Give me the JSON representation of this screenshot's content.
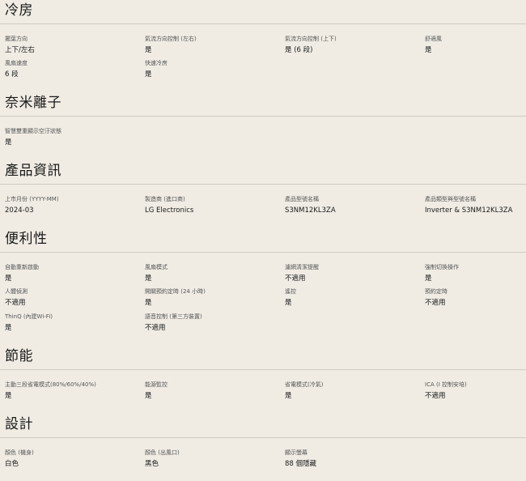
{
  "sections": [
    {
      "title": "冷房",
      "specs": [
        {
          "label": "擺葉方向",
          "value": "上下/左右"
        },
        {
          "label": "氣流方向控制 (左右)",
          "value": "是"
        },
        {
          "label": "氣流方向控制 (上下)",
          "value": "是 (6 段)"
        },
        {
          "label": "舒適風",
          "value": "是"
        },
        {
          "label": "風扇速度",
          "value": "6 段"
        },
        {
          "label": "快速冷房",
          "value": "是"
        }
      ]
    },
    {
      "title": "奈米離子",
      "specs": [
        {
          "label": "智慧雙重顯示空汙狀態",
          "value": "是"
        }
      ]
    },
    {
      "title": "產品資訊",
      "specs": [
        {
          "label": "上市月份 (YYYY-MM)",
          "value": "2024-03"
        },
        {
          "label": "製造商 (進口商)",
          "value": "LG Electronics"
        },
        {
          "label": "產品型號名稱",
          "value": "S3NM12KL3ZA"
        },
        {
          "label": "產品類型與型號名稱",
          "value": "Inverter & S3NM12KL3ZA"
        }
      ]
    },
    {
      "title": "便利性",
      "specs": [
        {
          "label": "自動重新啟動",
          "value": "是"
        },
        {
          "label": "風扇模式",
          "value": "是"
        },
        {
          "label": "濾網清潔提醒",
          "value": "不適用"
        },
        {
          "label": "強制切換操作",
          "value": "是"
        },
        {
          "label": "人體偵測",
          "value": "不適用"
        },
        {
          "label": "開關預約定時 (24 小時)",
          "value": "是"
        },
        {
          "label": "遙控",
          "value": "是"
        },
        {
          "label": "預約定時",
          "value": "不適用"
        },
        {
          "label": "ThinQ (內建Wi-Fi)",
          "value": "是"
        },
        {
          "label": "語音控制 (第三方裝置)",
          "value": "不適用"
        }
      ]
    },
    {
      "title": "節能",
      "specs": [
        {
          "label": "主動三段省電模式(80%/60%/40%)",
          "value": "是"
        },
        {
          "label": "能源監控",
          "value": "是"
        },
        {
          "label": "省電模式(冷氣)",
          "value": "是"
        },
        {
          "label": "ICA (I 控制安培)",
          "value": "不適用"
        }
      ]
    },
    {
      "title": "設計",
      "specs": [
        {
          "label": "顏色 (機身)",
          "value": "白色"
        },
        {
          "label": "顏色 (出風口)",
          "value": "黑色"
        },
        {
          "label": "顯示螢幕",
          "value": "88 個隱藏"
        }
      ]
    }
  ]
}
